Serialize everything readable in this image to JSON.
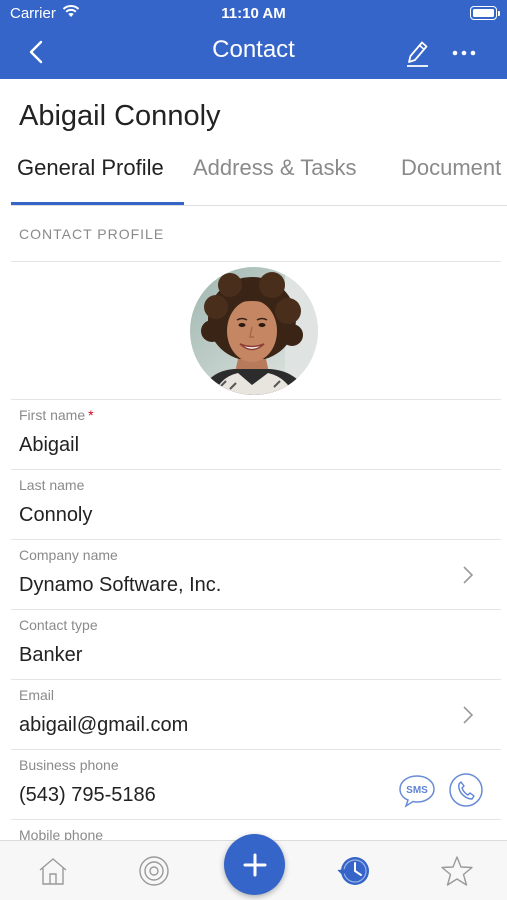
{
  "status_bar": {
    "carrier": "Carrier",
    "time": "11:10 AM"
  },
  "nav": {
    "title": "Contact"
  },
  "contact": {
    "name": "Abigail Connoly"
  },
  "tabs": [
    {
      "label": "General Profile",
      "active": true
    },
    {
      "label": "Address & Tasks",
      "active": false
    },
    {
      "label": "Document",
      "active": false
    }
  ],
  "section": {
    "heading": "CONTACT PROFILE"
  },
  "fields": {
    "first_name": {
      "label": "First name",
      "required_mark": "*",
      "value": "Abigail"
    },
    "last_name": {
      "label": "Last name",
      "value": "Connoly"
    },
    "company_name": {
      "label": "Company name",
      "value": "Dynamo Software, Inc."
    },
    "contact_type": {
      "label": "Contact type",
      "value": "Banker"
    },
    "email": {
      "label": "Email",
      "value": "abigail@gmail.com"
    },
    "business_phone": {
      "label": "Business phone",
      "value": "(543) 795-5186"
    },
    "mobile_phone": {
      "label": "Mobile phone"
    }
  },
  "actions": {
    "sms_label": "SMS"
  },
  "icons": [
    "back-icon",
    "edit-icon",
    "more-icon",
    "chevron-right-icon",
    "sms-icon",
    "phone-icon",
    "home-icon",
    "target-icon",
    "plus-icon",
    "history-icon",
    "star-icon"
  ],
  "colors": {
    "accent": "#3565c9",
    "required": "#d0021b",
    "label_gray": "#8a8a8a"
  }
}
